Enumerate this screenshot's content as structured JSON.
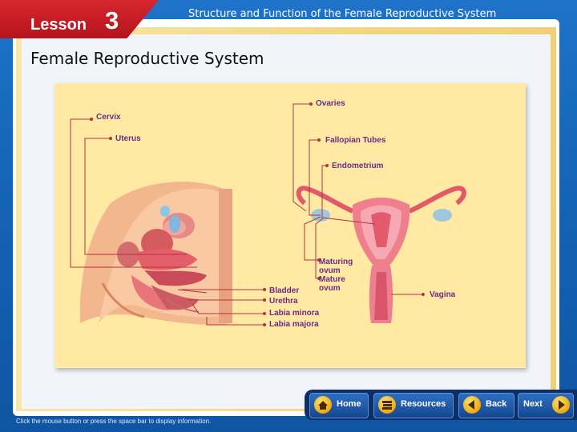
{
  "header": {
    "lesson_word": "Lesson",
    "lesson_number": "3",
    "title": "Structure and Function of the Female Reproductive System"
  },
  "page_title": "Female Reproductive System",
  "figure": {
    "labels": {
      "cervix": "Cervix",
      "uterus": "Uterus",
      "ovaries": "Ovaries",
      "fallopian_tubes": "Fallopian Tubes",
      "endometrium": "Endometrium",
      "maturing_ovum_1": "Maturing",
      "maturing_ovum_2": "ovum",
      "mature_ovum_1": "Mature",
      "mature_ovum_2": "ovum",
      "vagina": "Vagina",
      "bladder": "Bladder",
      "urethra": "Urethra",
      "labia_minora": "Labia minora",
      "labia_majora": "Labia majora"
    }
  },
  "footer_hint": "Click the mouse button or press the space bar to display information.",
  "nav": {
    "home": "Home",
    "resources": "Resources",
    "back": "Back",
    "next": "Next"
  },
  "colors": {
    "header_red": "#c81d25",
    "background_blue": "#1565b8",
    "label_purple": "#6a2a85",
    "leader_red": "#b8323c",
    "nav_gold": "#f0a70f"
  }
}
